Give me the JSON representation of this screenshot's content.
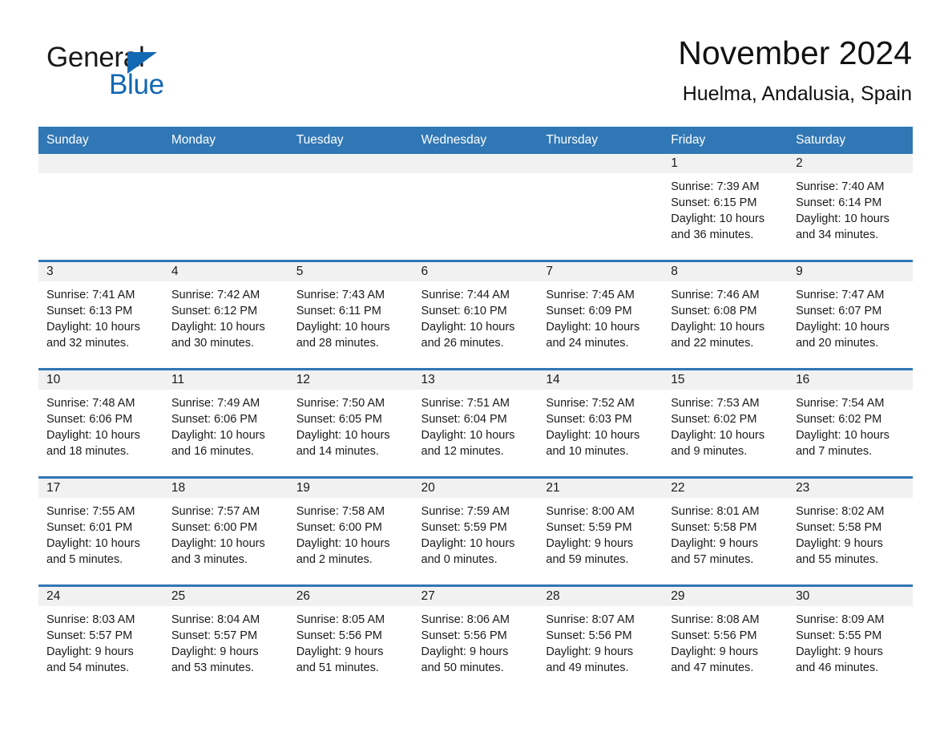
{
  "brand": {
    "word_one": "General",
    "word_two": "Blue",
    "triangle_color": "#1268b3"
  },
  "header": {
    "title": "November 2024",
    "subtitle": "Huelma, Andalusia, Spain"
  },
  "theme": {
    "header_blue": "#3077b5",
    "row_separator_blue": "#3077b5",
    "daynum_band": "#f1f1f1",
    "text": "#1a1a1a"
  },
  "weekday_headers": [
    "Sunday",
    "Monday",
    "Tuesday",
    "Wednesday",
    "Thursday",
    "Friday",
    "Saturday"
  ],
  "weeks": [
    [
      {
        "day": "",
        "blank": true,
        "sunrise": "",
        "sunset": "",
        "daylight_line1": "",
        "daylight_line2": ""
      },
      {
        "day": "",
        "blank": true,
        "sunrise": "",
        "sunset": "",
        "daylight_line1": "",
        "daylight_line2": ""
      },
      {
        "day": "",
        "blank": true,
        "sunrise": "",
        "sunset": "",
        "daylight_line1": "",
        "daylight_line2": ""
      },
      {
        "day": "",
        "blank": true,
        "sunrise": "",
        "sunset": "",
        "daylight_line1": "",
        "daylight_line2": ""
      },
      {
        "day": "",
        "blank": true,
        "sunrise": "",
        "sunset": "",
        "daylight_line1": "",
        "daylight_line2": ""
      },
      {
        "day": "1",
        "blank": false,
        "sunrise": "Sunrise: 7:39 AM",
        "sunset": "Sunset: 6:15 PM",
        "daylight_line1": "Daylight: 10 hours",
        "daylight_line2": "and 36 minutes."
      },
      {
        "day": "2",
        "blank": false,
        "sunrise": "Sunrise: 7:40 AM",
        "sunset": "Sunset: 6:14 PM",
        "daylight_line1": "Daylight: 10 hours",
        "daylight_line2": "and 34 minutes."
      }
    ],
    [
      {
        "day": "3",
        "blank": false,
        "sunrise": "Sunrise: 7:41 AM",
        "sunset": "Sunset: 6:13 PM",
        "daylight_line1": "Daylight: 10 hours",
        "daylight_line2": "and 32 minutes."
      },
      {
        "day": "4",
        "blank": false,
        "sunrise": "Sunrise: 7:42 AM",
        "sunset": "Sunset: 6:12 PM",
        "daylight_line1": "Daylight: 10 hours",
        "daylight_line2": "and 30 minutes."
      },
      {
        "day": "5",
        "blank": false,
        "sunrise": "Sunrise: 7:43 AM",
        "sunset": "Sunset: 6:11 PM",
        "daylight_line1": "Daylight: 10 hours",
        "daylight_line2": "and 28 minutes."
      },
      {
        "day": "6",
        "blank": false,
        "sunrise": "Sunrise: 7:44 AM",
        "sunset": "Sunset: 6:10 PM",
        "daylight_line1": "Daylight: 10 hours",
        "daylight_line2": "and 26 minutes."
      },
      {
        "day": "7",
        "blank": false,
        "sunrise": "Sunrise: 7:45 AM",
        "sunset": "Sunset: 6:09 PM",
        "daylight_line1": "Daylight: 10 hours",
        "daylight_line2": "and 24 minutes."
      },
      {
        "day": "8",
        "blank": false,
        "sunrise": "Sunrise: 7:46 AM",
        "sunset": "Sunset: 6:08 PM",
        "daylight_line1": "Daylight: 10 hours",
        "daylight_line2": "and 22 minutes."
      },
      {
        "day": "9",
        "blank": false,
        "sunrise": "Sunrise: 7:47 AM",
        "sunset": "Sunset: 6:07 PM",
        "daylight_line1": "Daylight: 10 hours",
        "daylight_line2": "and 20 minutes."
      }
    ],
    [
      {
        "day": "10",
        "blank": false,
        "sunrise": "Sunrise: 7:48 AM",
        "sunset": "Sunset: 6:06 PM",
        "daylight_line1": "Daylight: 10 hours",
        "daylight_line2": "and 18 minutes."
      },
      {
        "day": "11",
        "blank": false,
        "sunrise": "Sunrise: 7:49 AM",
        "sunset": "Sunset: 6:06 PM",
        "daylight_line1": "Daylight: 10 hours",
        "daylight_line2": "and 16 minutes."
      },
      {
        "day": "12",
        "blank": false,
        "sunrise": "Sunrise: 7:50 AM",
        "sunset": "Sunset: 6:05 PM",
        "daylight_line1": "Daylight: 10 hours",
        "daylight_line2": "and 14 minutes."
      },
      {
        "day": "13",
        "blank": false,
        "sunrise": "Sunrise: 7:51 AM",
        "sunset": "Sunset: 6:04 PM",
        "daylight_line1": "Daylight: 10 hours",
        "daylight_line2": "and 12 minutes."
      },
      {
        "day": "14",
        "blank": false,
        "sunrise": "Sunrise: 7:52 AM",
        "sunset": "Sunset: 6:03 PM",
        "daylight_line1": "Daylight: 10 hours",
        "daylight_line2": "and 10 minutes."
      },
      {
        "day": "15",
        "blank": false,
        "sunrise": "Sunrise: 7:53 AM",
        "sunset": "Sunset: 6:02 PM",
        "daylight_line1": "Daylight: 10 hours",
        "daylight_line2": "and 9 minutes."
      },
      {
        "day": "16",
        "blank": false,
        "sunrise": "Sunrise: 7:54 AM",
        "sunset": "Sunset: 6:02 PM",
        "daylight_line1": "Daylight: 10 hours",
        "daylight_line2": "and 7 minutes."
      }
    ],
    [
      {
        "day": "17",
        "blank": false,
        "sunrise": "Sunrise: 7:55 AM",
        "sunset": "Sunset: 6:01 PM",
        "daylight_line1": "Daylight: 10 hours",
        "daylight_line2": "and 5 minutes."
      },
      {
        "day": "18",
        "blank": false,
        "sunrise": "Sunrise: 7:57 AM",
        "sunset": "Sunset: 6:00 PM",
        "daylight_line1": "Daylight: 10 hours",
        "daylight_line2": "and 3 minutes."
      },
      {
        "day": "19",
        "blank": false,
        "sunrise": "Sunrise: 7:58 AM",
        "sunset": "Sunset: 6:00 PM",
        "daylight_line1": "Daylight: 10 hours",
        "daylight_line2": "and 2 minutes."
      },
      {
        "day": "20",
        "blank": false,
        "sunrise": "Sunrise: 7:59 AM",
        "sunset": "Sunset: 5:59 PM",
        "daylight_line1": "Daylight: 10 hours",
        "daylight_line2": "and 0 minutes."
      },
      {
        "day": "21",
        "blank": false,
        "sunrise": "Sunrise: 8:00 AM",
        "sunset": "Sunset: 5:59 PM",
        "daylight_line1": "Daylight: 9 hours",
        "daylight_line2": "and 59 minutes."
      },
      {
        "day": "22",
        "blank": false,
        "sunrise": "Sunrise: 8:01 AM",
        "sunset": "Sunset: 5:58 PM",
        "daylight_line1": "Daylight: 9 hours",
        "daylight_line2": "and 57 minutes."
      },
      {
        "day": "23",
        "blank": false,
        "sunrise": "Sunrise: 8:02 AM",
        "sunset": "Sunset: 5:58 PM",
        "daylight_line1": "Daylight: 9 hours",
        "daylight_line2": "and 55 minutes."
      }
    ],
    [
      {
        "day": "24",
        "blank": false,
        "sunrise": "Sunrise: 8:03 AM",
        "sunset": "Sunset: 5:57 PM",
        "daylight_line1": "Daylight: 9 hours",
        "daylight_line2": "and 54 minutes."
      },
      {
        "day": "25",
        "blank": false,
        "sunrise": "Sunrise: 8:04 AM",
        "sunset": "Sunset: 5:57 PM",
        "daylight_line1": "Daylight: 9 hours",
        "daylight_line2": "and 53 minutes."
      },
      {
        "day": "26",
        "blank": false,
        "sunrise": "Sunrise: 8:05 AM",
        "sunset": "Sunset: 5:56 PM",
        "daylight_line1": "Daylight: 9 hours",
        "daylight_line2": "and 51 minutes."
      },
      {
        "day": "27",
        "blank": false,
        "sunrise": "Sunrise: 8:06 AM",
        "sunset": "Sunset: 5:56 PM",
        "daylight_line1": "Daylight: 9 hours",
        "daylight_line2": "and 50 minutes."
      },
      {
        "day": "28",
        "blank": false,
        "sunrise": "Sunrise: 8:07 AM",
        "sunset": "Sunset: 5:56 PM",
        "daylight_line1": "Daylight: 9 hours",
        "daylight_line2": "and 49 minutes."
      },
      {
        "day": "29",
        "blank": false,
        "sunrise": "Sunrise: 8:08 AM",
        "sunset": "Sunset: 5:56 PM",
        "daylight_line1": "Daylight: 9 hours",
        "daylight_line2": "and 47 minutes."
      },
      {
        "day": "30",
        "blank": false,
        "sunrise": "Sunrise: 8:09 AM",
        "sunset": "Sunset: 5:55 PM",
        "daylight_line1": "Daylight: 9 hours",
        "daylight_line2": "and 46 minutes."
      }
    ]
  ]
}
